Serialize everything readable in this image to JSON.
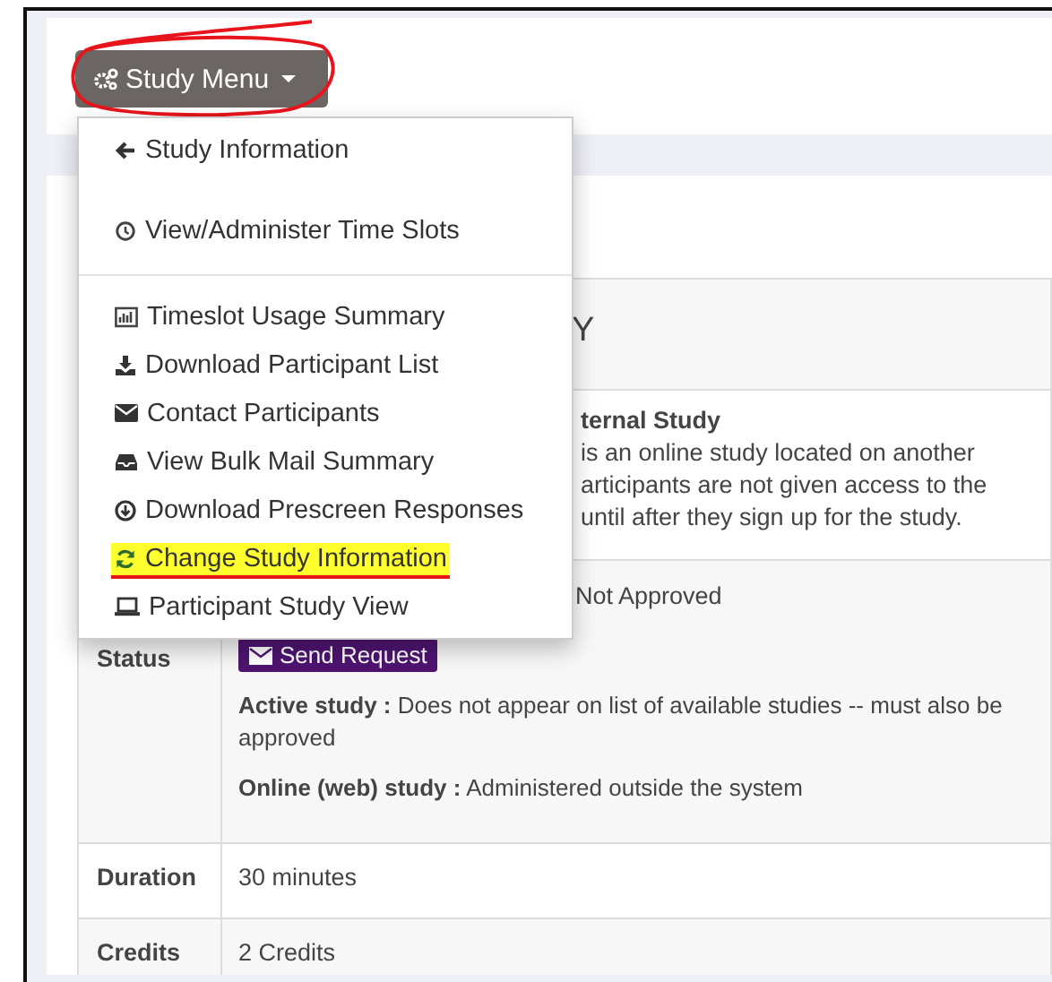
{
  "study_menu": {
    "label": "Study Menu",
    "expanded": true,
    "circled": true
  },
  "menu_groups": [
    [
      {
        "label": "Study Information",
        "highlighted": false
      },
      {
        "label": "View/Administer Time Slots",
        "highlighted": false
      }
    ],
    [
      {
        "label": "Timeslot Usage Summary",
        "highlighted": false
      },
      {
        "label": "Download Participant List",
        "highlighted": false
      },
      {
        "label": "Contact Participants",
        "highlighted": false
      },
      {
        "label": "View Bulk Mail Summary",
        "highlighted": false
      },
      {
        "label": "Download Prescreen Responses",
        "highlighted": false
      },
      {
        "label": "Change Study Information",
        "highlighted": true
      },
      {
        "label": "Participant Study View",
        "highlighted": false
      }
    ]
  ],
  "table": {
    "heading": "Y",
    "rows": [
      {
        "kind": "partial",
        "title": "ternal Study",
        "lines": [
          "is an online study located on another",
          "articipants are not given access to the",
          "until after they sign up for the study."
        ]
      },
      {
        "kind": "status",
        "label": "Status",
        "value": "Not Approved",
        "button": "Send Request",
        "notes": [
          "**Active study :** Does not appear on list of available studies -- must also be approved",
          "**Online (web) study :** Administered outside the system"
        ]
      },
      {
        "kind": "plain",
        "label": "Duration",
        "value": "30 minutes"
      },
      {
        "kind": "plain",
        "label": "Credits",
        "value": "2 Credits"
      }
    ]
  }
}
